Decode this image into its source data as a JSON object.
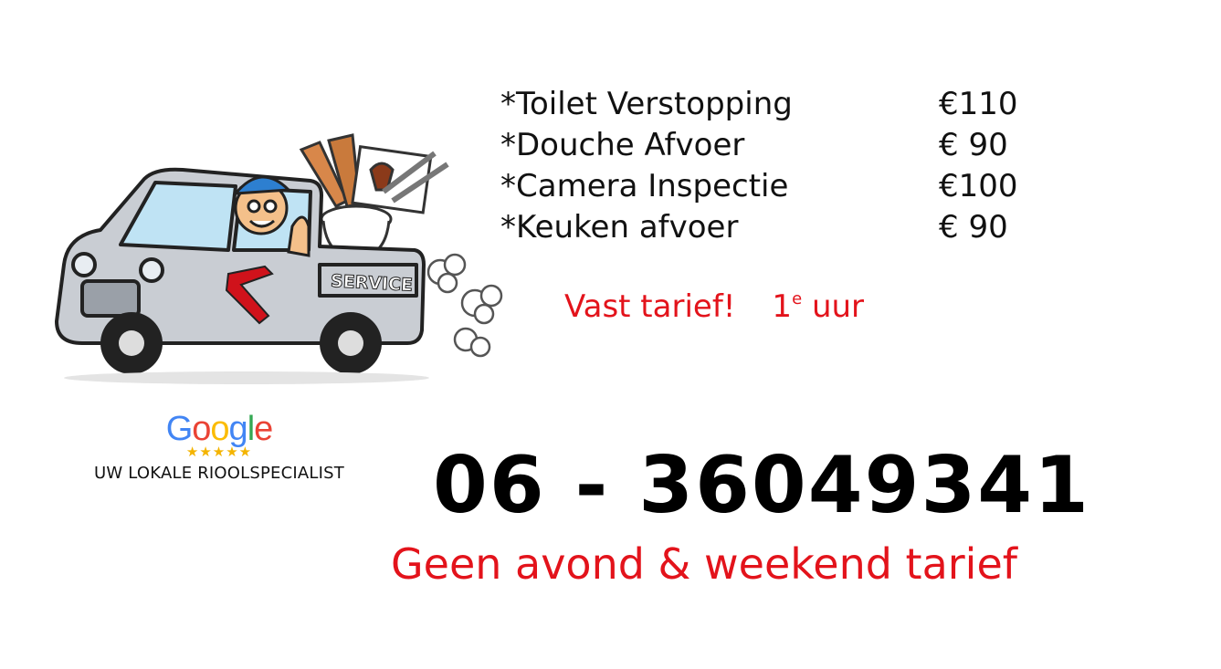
{
  "services": [
    {
      "name": "*Toilet Verstopping",
      "price": "€110"
    },
    {
      "name": "*Douche Afvoer",
      "price": "€ 90"
    },
    {
      "name": "*Camera Inspectie",
      "price": "€100"
    },
    {
      "name": "*Keuken afvoer",
      "price": "€ 90"
    }
  ],
  "fixed_rate": {
    "label": "Vast tarief!",
    "hour_number": "1",
    "hour_suffix": "e",
    "hour_word": "uur"
  },
  "truck": {
    "sign": "SERVICE"
  },
  "google": {
    "letters": [
      {
        "char": "G",
        "color": "#4285f4"
      },
      {
        "char": "o",
        "color": "#ea4335"
      },
      {
        "char": "o",
        "color": "#fbbc05"
      },
      {
        "char": "g",
        "color": "#4285f4"
      },
      {
        "char": "l",
        "color": "#34a853"
      },
      {
        "char": "e",
        "color": "#ea4335"
      }
    ],
    "stars": "★★★★★",
    "tagline": "UW LOKALE RIOOLSPECIALIST"
  },
  "phone": "06 - 36049341",
  "footer_note": "Geen avond & weekend tarief",
  "colors": {
    "accent_red": "#e3131b",
    "text": "#111111",
    "star": "#f4b400"
  }
}
